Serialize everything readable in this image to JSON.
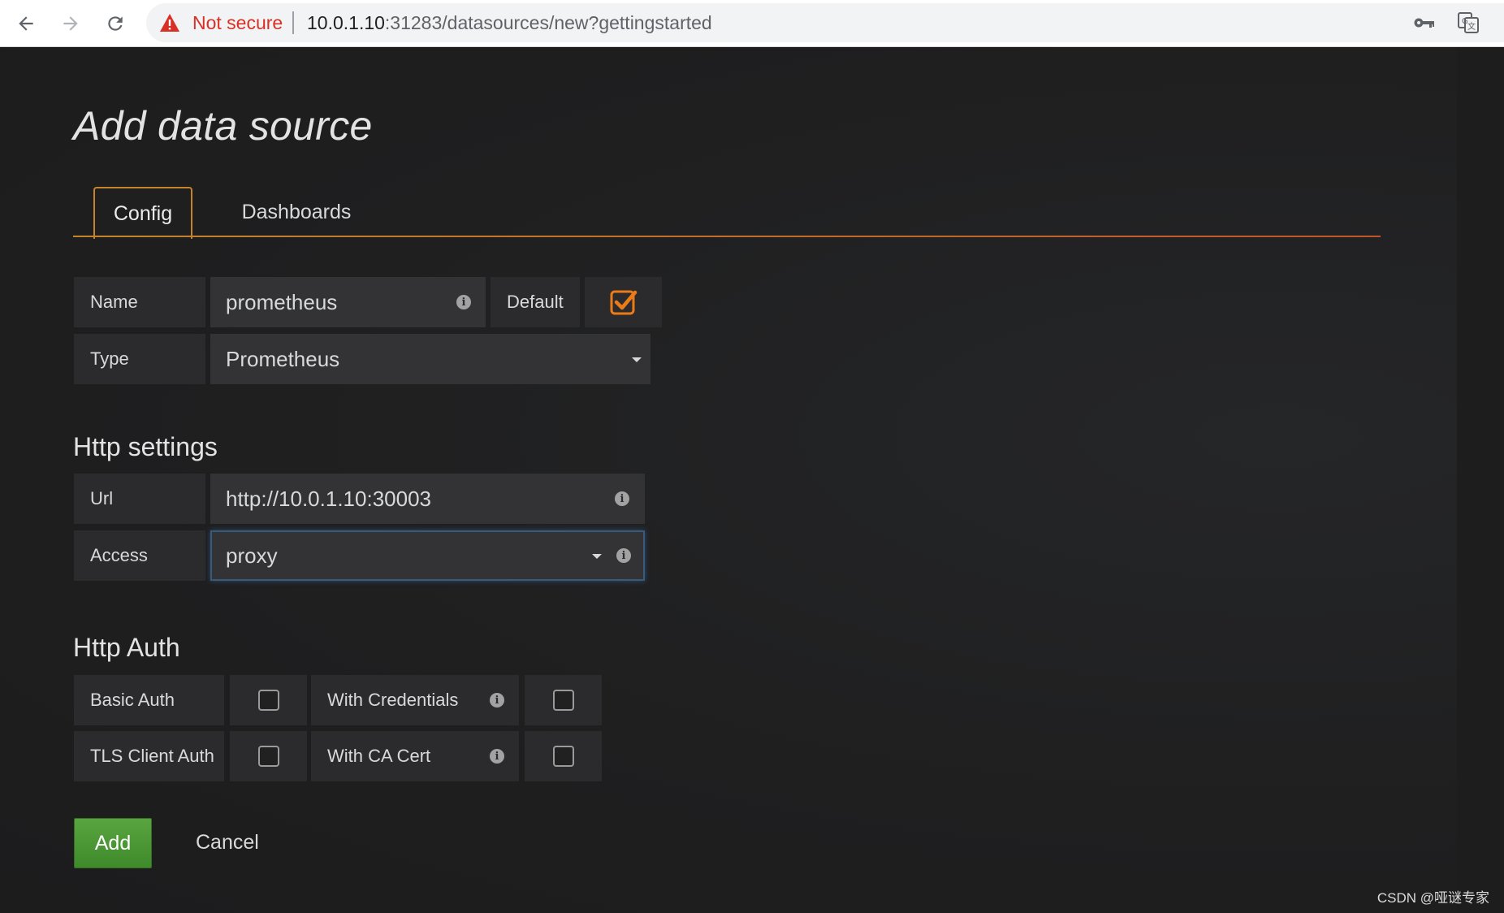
{
  "browser": {
    "security_label": "Not secure",
    "url_host": "10.0.1.10",
    "url_rest": ":31283/datasources/new?gettingstarted",
    "icons": [
      "back-arrow-icon",
      "forward-arrow-icon",
      "reload-icon",
      "warning-icon",
      "key-icon",
      "translate-icon"
    ],
    "warning_color": "#d93025"
  },
  "page": {
    "title": "Add data source",
    "tabs": [
      {
        "label": "Config",
        "active": true
      },
      {
        "label": "Dashboards",
        "active": false
      }
    ],
    "accent_color": "#c4842c"
  },
  "form": {
    "name_label": "Name",
    "name_value": "prometheus",
    "default_label": "Default",
    "default_checked": true,
    "type_label": "Type",
    "type_value": "Prometheus"
  },
  "http_settings": {
    "title": "Http settings",
    "url_label": "Url",
    "url_value": "http://10.0.1.10:30003",
    "access_label": "Access",
    "access_value": "proxy"
  },
  "http_auth": {
    "title": "Http Auth",
    "basic_auth_label": "Basic Auth",
    "basic_auth_checked": false,
    "with_credentials_label": "With Credentials",
    "with_credentials_checked": false,
    "tls_client_auth_label": "TLS Client Auth",
    "tls_client_auth_checked": false,
    "with_ca_cert_label": "With CA Cert",
    "with_ca_cert_checked": false
  },
  "actions": {
    "add_label": "Add",
    "add_color": "#4a9a35",
    "cancel_label": "Cancel"
  },
  "watermark": "CSDN @哑谜专家"
}
